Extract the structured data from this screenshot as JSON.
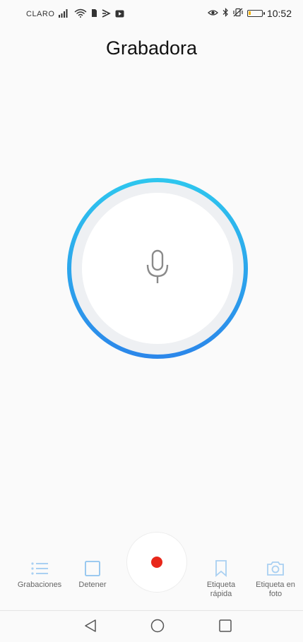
{
  "status_bar": {
    "carrier": "CLARO",
    "time": "10:52",
    "battery_level": 0.2,
    "icons": [
      "signal-icon",
      "wifi-icon",
      "sim-icon",
      "media-icon",
      "video-icon",
      "eye-comfort-icon",
      "bluetooth-icon",
      "vibrate-off-icon",
      "battery-icon"
    ]
  },
  "header": {
    "title": "Grabadora"
  },
  "recorder": {
    "mic_icon": "microphone-icon",
    "ring_gradient": [
      "#2ec6ee",
      "#2b87ea"
    ],
    "inner_fill": "#ffffff",
    "track_color": "#eef0f3"
  },
  "toolbar": {
    "recordings_label": "Grabaciones",
    "stop_label": "Detener",
    "quick_tag_label_line1": "Etiqueta",
    "quick_tag_label_line2": "rápida",
    "photo_tag_label_line1": "Etiqueta en",
    "photo_tag_label_line2": "foto",
    "record_color": "#e8271a",
    "icon_active_color": "#8fc4ef",
    "icon_disabled_color": "#a9d0f2"
  },
  "nav": {
    "back_icon": "back-triangle-icon",
    "home_icon": "home-circle-icon",
    "recents_icon": "recents-square-icon"
  }
}
